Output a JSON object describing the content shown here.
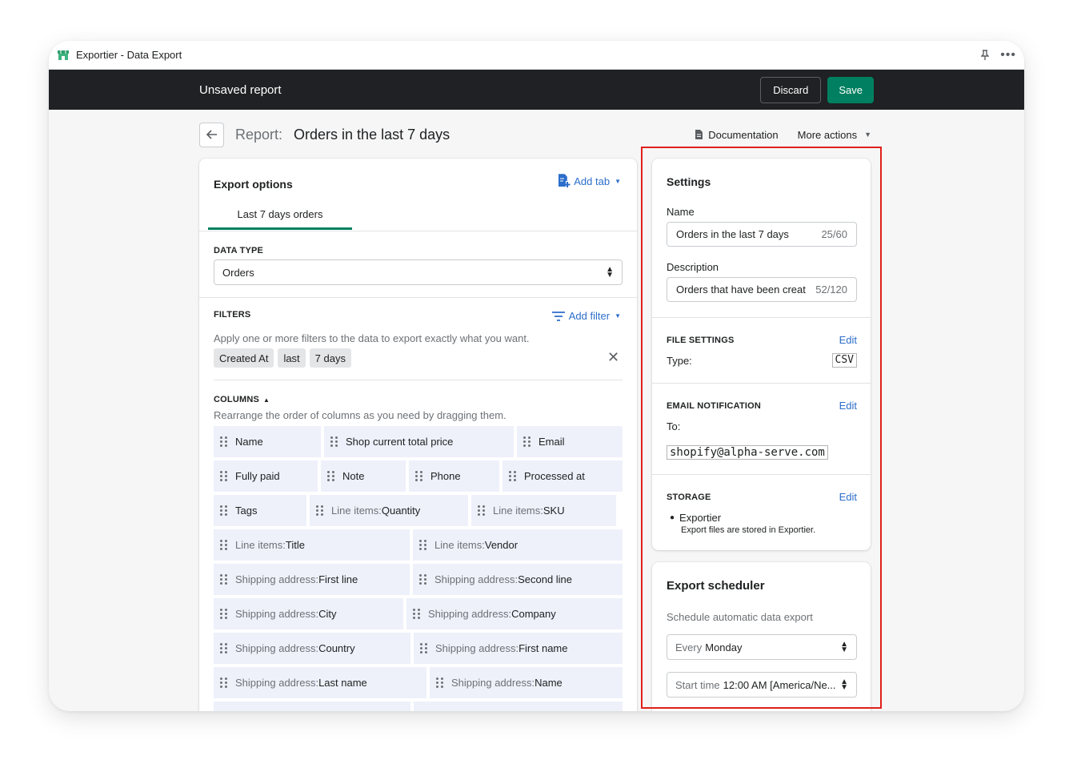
{
  "window": {
    "app_title": "Exportier - Data Export",
    "pin_icon": "pin-icon",
    "more_icon": "more-horizontal-icon"
  },
  "topbar": {
    "title": "Unsaved report",
    "discard_label": "Discard",
    "save_label": "Save"
  },
  "header": {
    "report_label": "Report:",
    "report_name": "Orders in the last 7 days",
    "documentation_label": "Documentation",
    "more_actions_label": "More actions"
  },
  "export_options": {
    "title": "Export options",
    "add_tab_label": "Add tab",
    "tab_label": "Last 7 days orders",
    "data_type_label": "DATA TYPE",
    "data_type_value": "Orders",
    "filters_label": "FILTERS",
    "add_filter_label": "Add filter",
    "filters_help": "Apply one or more filters to the data to export exactly what you want.",
    "filter_tags": [
      "Created At",
      "last",
      "7 days"
    ],
    "columns_label": "COLUMNS",
    "columns_help": "Rearrange the order of columns as you need by dragging them.",
    "columns": [
      [
        {
          "pre": "",
          "name": "Name"
        },
        {
          "pre": "",
          "name": "Shop current total price"
        },
        {
          "pre": "",
          "name": "Email"
        }
      ],
      [
        {
          "pre": "",
          "name": "Fully paid"
        },
        {
          "pre": "",
          "name": "Note"
        },
        {
          "pre": "",
          "name": "Phone"
        },
        {
          "pre": "",
          "name": "Processed at"
        }
      ],
      [
        {
          "pre": "",
          "name": "Tags"
        },
        {
          "pre": "Line items: ",
          "name": "Quantity"
        },
        {
          "pre": "Line items: ",
          "name": "SKU"
        }
      ],
      [
        {
          "pre": "Line items: ",
          "name": "Title"
        },
        {
          "pre": "Line items: ",
          "name": "Vendor"
        }
      ],
      [
        {
          "pre": "Shipping address: ",
          "name": "First line"
        },
        {
          "pre": "Shipping address: ",
          "name": "Second line"
        }
      ],
      [
        {
          "pre": "Shipping address: ",
          "name": "City"
        },
        {
          "pre": "Shipping address: ",
          "name": "Company"
        }
      ],
      [
        {
          "pre": "Shipping address: ",
          "name": "Country"
        },
        {
          "pre": "Shipping address: ",
          "name": "First name"
        }
      ],
      [
        {
          "pre": "Shipping address: ",
          "name": "Last name"
        },
        {
          "pre": "Shipping address: ",
          "name": "Name"
        }
      ]
    ]
  },
  "settings": {
    "title": "Settings",
    "name_label": "Name",
    "name_value": "Orders in the last 7 days",
    "name_count": "25/60",
    "description_label": "Description",
    "description_value": "Orders that have been creat",
    "description_count": "52/120",
    "file_settings_label": "FILE SETTINGS",
    "file_edit": "Edit",
    "type_label": "Type:",
    "type_value": "CSV",
    "email_label": "EMAIL NOTIFICATION",
    "email_edit": "Edit",
    "to_label": "To:",
    "email_value": "shopify@alpha-serve.com",
    "storage_label": "STORAGE",
    "storage_edit": "Edit",
    "storage_name": "Exportier",
    "storage_desc": "Export files are stored in Exportier."
  },
  "scheduler": {
    "title": "Export scheduler",
    "help": "Schedule automatic data export",
    "frequency_prefix": "Every",
    "frequency_value": "Monday",
    "start_prefix": "Start time",
    "start_value": "12:00 AM [America/Ne..."
  },
  "colors": {
    "accent": "#2c6ecb",
    "primary": "#008060",
    "highlight_border": "#e0201b",
    "topbar": "#1f2124"
  }
}
